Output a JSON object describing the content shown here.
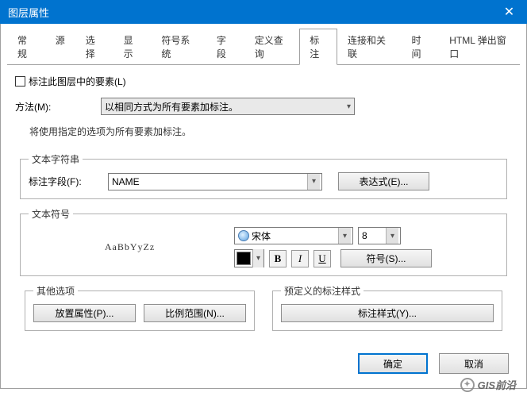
{
  "window": {
    "title": "图层属性",
    "close": "✕"
  },
  "tabs": {
    "items": [
      {
        "label": "常规"
      },
      {
        "label": "源"
      },
      {
        "label": "选择"
      },
      {
        "label": "显示"
      },
      {
        "label": "符号系统"
      },
      {
        "label": "字段"
      },
      {
        "label": "定义查询"
      },
      {
        "label": "标注"
      },
      {
        "label": "连接和关联"
      },
      {
        "label": "时间"
      },
      {
        "label": "HTML 弹出窗口"
      }
    ],
    "active_index": 7
  },
  "label_checkbox": "标注此图层中的要素(L)",
  "method": {
    "label": "方法(M):",
    "value": "以相同方式为所有要素加标注。"
  },
  "description": "将使用指定的选项为所有要素加标注。",
  "text_string": {
    "legend": "文本字符串",
    "field_label": "标注字段(F):",
    "field_value": "NAME",
    "expression_btn": "表达式(E)..."
  },
  "text_symbol": {
    "legend": "文本符号",
    "sample": "AaBbYyZz",
    "font": "宋体",
    "size": "8",
    "bold": "B",
    "italic": "I",
    "underline": "U",
    "symbol_btn": "符号(S)..."
  },
  "other_options": {
    "legend": "其他选项",
    "placement_btn": "放置属性(P)...",
    "scale_btn": "比例范围(N)..."
  },
  "predefined": {
    "legend": "预定义的标注样式",
    "style_btn": "标注样式(Y)..."
  },
  "buttons": {
    "ok": "确定",
    "cancel": "取消"
  },
  "watermark": "GIS前沿"
}
